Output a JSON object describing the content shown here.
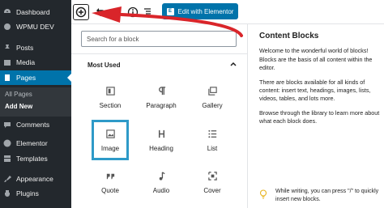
{
  "sidebar": {
    "items": [
      {
        "label": "Dashboard",
        "icon": "dashboard-icon"
      },
      {
        "label": "WPMU DEV",
        "icon": "wpmudev-icon"
      },
      {
        "label": "Posts",
        "icon": "pin-icon"
      },
      {
        "label": "Media",
        "icon": "media-icon"
      },
      {
        "label": "Pages",
        "icon": "pages-icon",
        "active": true
      },
      {
        "label": "Comments",
        "icon": "comments-icon"
      },
      {
        "label": "Elementor",
        "icon": "elementor-icon"
      },
      {
        "label": "Templates",
        "icon": "templates-icon"
      },
      {
        "label": "Appearance",
        "icon": "brush-icon"
      },
      {
        "label": "Plugins",
        "icon": "plugin-icon"
      }
    ],
    "submenu": [
      "All Pages",
      "Add New"
    ]
  },
  "toolbar": {
    "elementor_label": "Edit with Elementor"
  },
  "inserter": {
    "search_placeholder": "Search for a block",
    "section_title": "Most Used",
    "blocks": [
      {
        "label": "Section",
        "icon": "section-icon"
      },
      {
        "label": "Paragraph",
        "icon": "paragraph-icon"
      },
      {
        "label": "Gallery",
        "icon": "gallery-icon"
      },
      {
        "label": "Image",
        "icon": "image-icon",
        "selected": true
      },
      {
        "label": "Heading",
        "icon": "heading-icon"
      },
      {
        "label": "List",
        "icon": "list-icon"
      },
      {
        "label": "Quote",
        "icon": "quote-icon"
      },
      {
        "label": "Audio",
        "icon": "audio-icon"
      },
      {
        "label": "Cover",
        "icon": "cover-icon"
      }
    ]
  },
  "help": {
    "title": "Content Blocks",
    "paragraphs": [
      "Welcome to the wonderful world of blocks! Blocks are the basis of all content within the editor.",
      "There are blocks available for all kinds of content: insert text, headings, images, lists, videos, tables, and lots more.",
      "Browse through the library to learn more about what each block does."
    ],
    "tip": "While writing, you can press \"/\" to quickly insert new blocks."
  },
  "colors": {
    "sidebar_bg": "#23282d",
    "active": "#0073aa",
    "selected_border": "#2e9ac8",
    "annotation_arrow": "#d9252a"
  }
}
